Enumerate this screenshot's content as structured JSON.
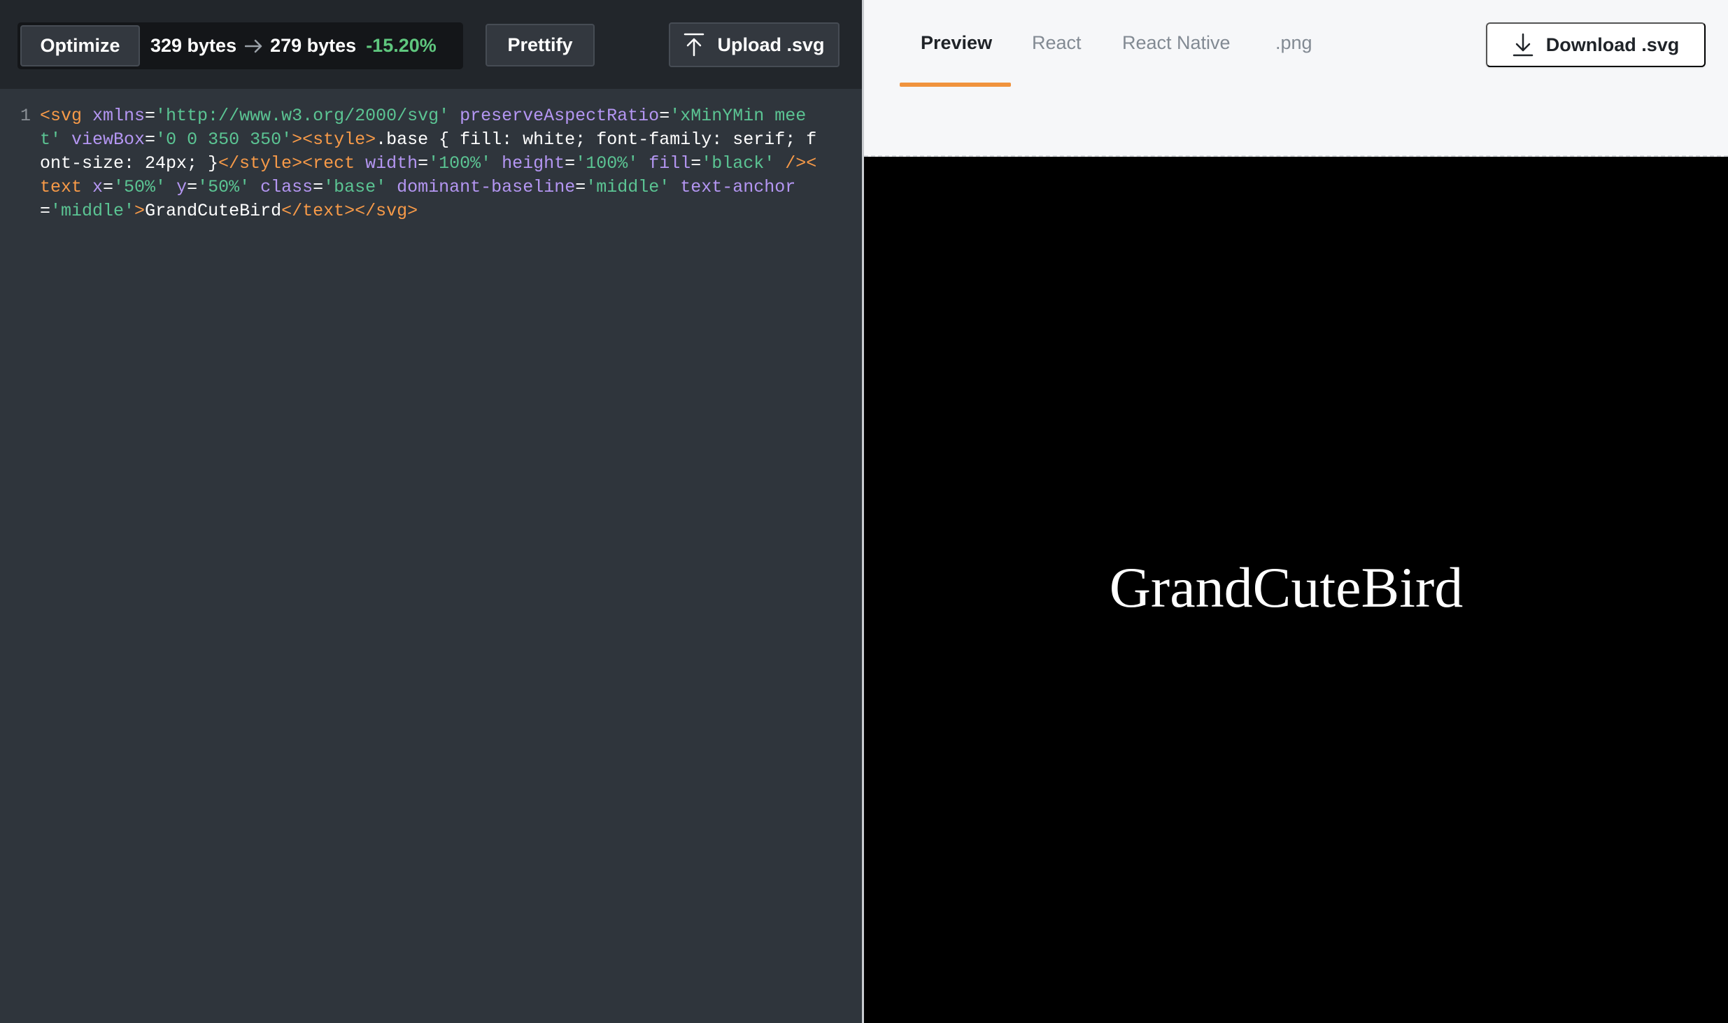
{
  "toolbar": {
    "optimize_label": "Optimize",
    "original_size": "329 bytes",
    "optimized_size": "279 bytes",
    "reduction": "-15.20%",
    "prettify_label": "Prettify",
    "upload_label": "Upload .svg"
  },
  "editor": {
    "line_numbers": [
      "1"
    ],
    "code": {
      "t1": "<svg",
      "a1": " xmlns",
      "e1": "=",
      "v1": "'http://www.w3.org/2000/svg'",
      "a2": " preserveAspectRatio",
      "e2": "=",
      "v2": "'xMinYMin meet'",
      "a3": " viewBox",
      "e3": "=",
      "v3": "'0 0 350 350'",
      "t2": "><style>",
      "s1": ".base { fill: white; font-family: serif; font-size: 24px; }",
      "t3": "</style><rect",
      "a4": " width",
      "e4": "=",
      "v4": "'100%'",
      "a5": " height",
      "e5": "=",
      "v5": "'100%'",
      "a6": " fill",
      "e6": "=",
      "v6": "'black'",
      "t4": " /><text",
      "a7": " x",
      "e7": "=",
      "v7": "'50%'",
      "a8": " y",
      "e8": "=",
      "v8": "'50%'",
      "a9": " class",
      "e9": "=",
      "v9": "'base'",
      "a10": " dominant-baseline",
      "e10": "=",
      "v10": "'middle'",
      "a11": " text-anchor",
      "e11": "=",
      "v11": "'middle'",
      "t5": ">",
      "c1": "GrandCuteBird",
      "t6": "</text></svg>"
    }
  },
  "tabs": {
    "preview": "Preview",
    "react": "React",
    "react_native": "React Native",
    "png": ".png"
  },
  "download_label": "Download .svg",
  "preview": {
    "text": "GrandCuteBird"
  },
  "colors": {
    "accent": "#f0933d",
    "reduction_green": "#5fc77e",
    "tag_orange": "#f79a48",
    "attr_purple": "#b496f2",
    "value_green": "#5bc493"
  },
  "icons": {
    "arrow": "arrow-right-icon",
    "upload": "upload-icon",
    "download": "download-icon"
  }
}
